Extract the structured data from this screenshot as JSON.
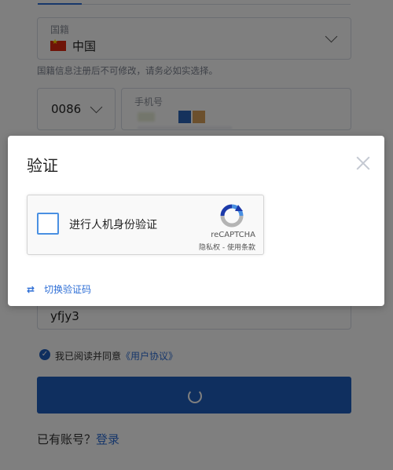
{
  "form": {
    "nationality": {
      "label": "国籍",
      "value": "中国",
      "flag_icon": "china-flag-icon"
    },
    "nationality_hint": "国籍信息注册后不可修改，请务必如实选择。",
    "country_code": "0086",
    "phone": {
      "placeholder": "手机号"
    },
    "captcha_input_value": "yfjy3",
    "agreement": {
      "prefix": "我已阅读并同意",
      "link": "《用户协议》"
    },
    "submit_state": "loading",
    "login_prompt": {
      "text": "已有账号？",
      "link": "登录"
    }
  },
  "dialog": {
    "title": "验证",
    "recaptcha": {
      "checkbox_label": "进行人机身份验证",
      "brand": "reCAPTCHA",
      "privacy": "隐私权",
      "separator": " - ",
      "terms": "使用条款"
    },
    "switch_label": "切换验证码"
  },
  "colors": {
    "accent": "#1f5fbf",
    "link": "#2f6fd6",
    "overlay": "rgba(0,0,0,0.5)"
  }
}
